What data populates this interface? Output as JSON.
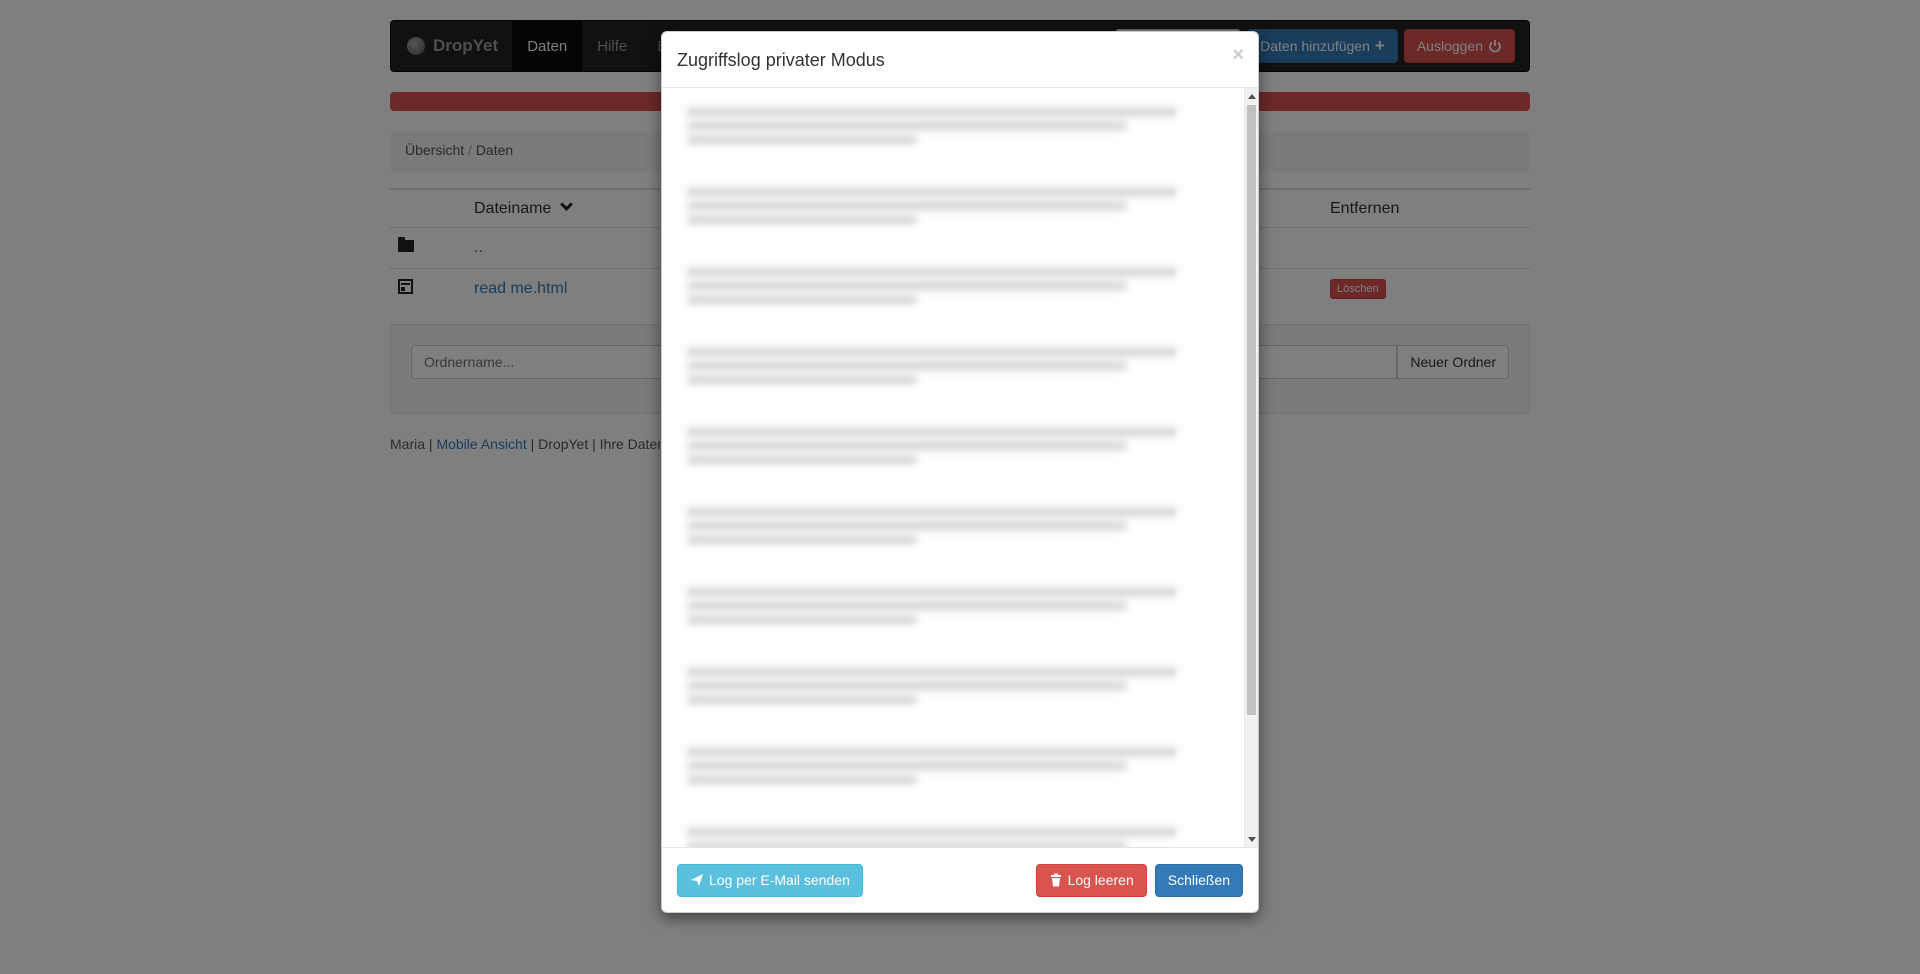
{
  "app": {
    "brand": "DropYet",
    "nav": [
      "Daten",
      "Hilfe",
      "E"
    ],
    "add_data_button": "Daten hinzufügen",
    "logout_button": "Ausloggen"
  },
  "breadcrumb": {
    "root": "Übersicht",
    "sep": "/",
    "current": "Daten"
  },
  "table": {
    "headers": {
      "name": "Dateiname",
      "remove": "Entfernen"
    },
    "rows": [
      {
        "icon": "folder-icon",
        "name": "..",
        "delete_label": ""
      },
      {
        "icon": "file-icon",
        "name": "read me.html",
        "delete_label": "Löschen"
      }
    ]
  },
  "folder_form": {
    "placeholder": "Ordnername...",
    "button": "Neuer Ordner"
  },
  "footer": {
    "user": "Maria",
    "mobile": "Mobile Ansicht",
    "brand": "DropYet",
    "rest": "Ihre Daten"
  },
  "modal": {
    "title": "Zugriffslog privater Modus",
    "close": "×",
    "send_email_button": "Log per E-Mail senden",
    "clear_log_button": "Log leeren",
    "close_button": "Schließen"
  },
  "colors": {
    "primary": "#337ab7",
    "danger": "#d9534f",
    "info": "#5bc0de",
    "navbar": "#222222"
  }
}
